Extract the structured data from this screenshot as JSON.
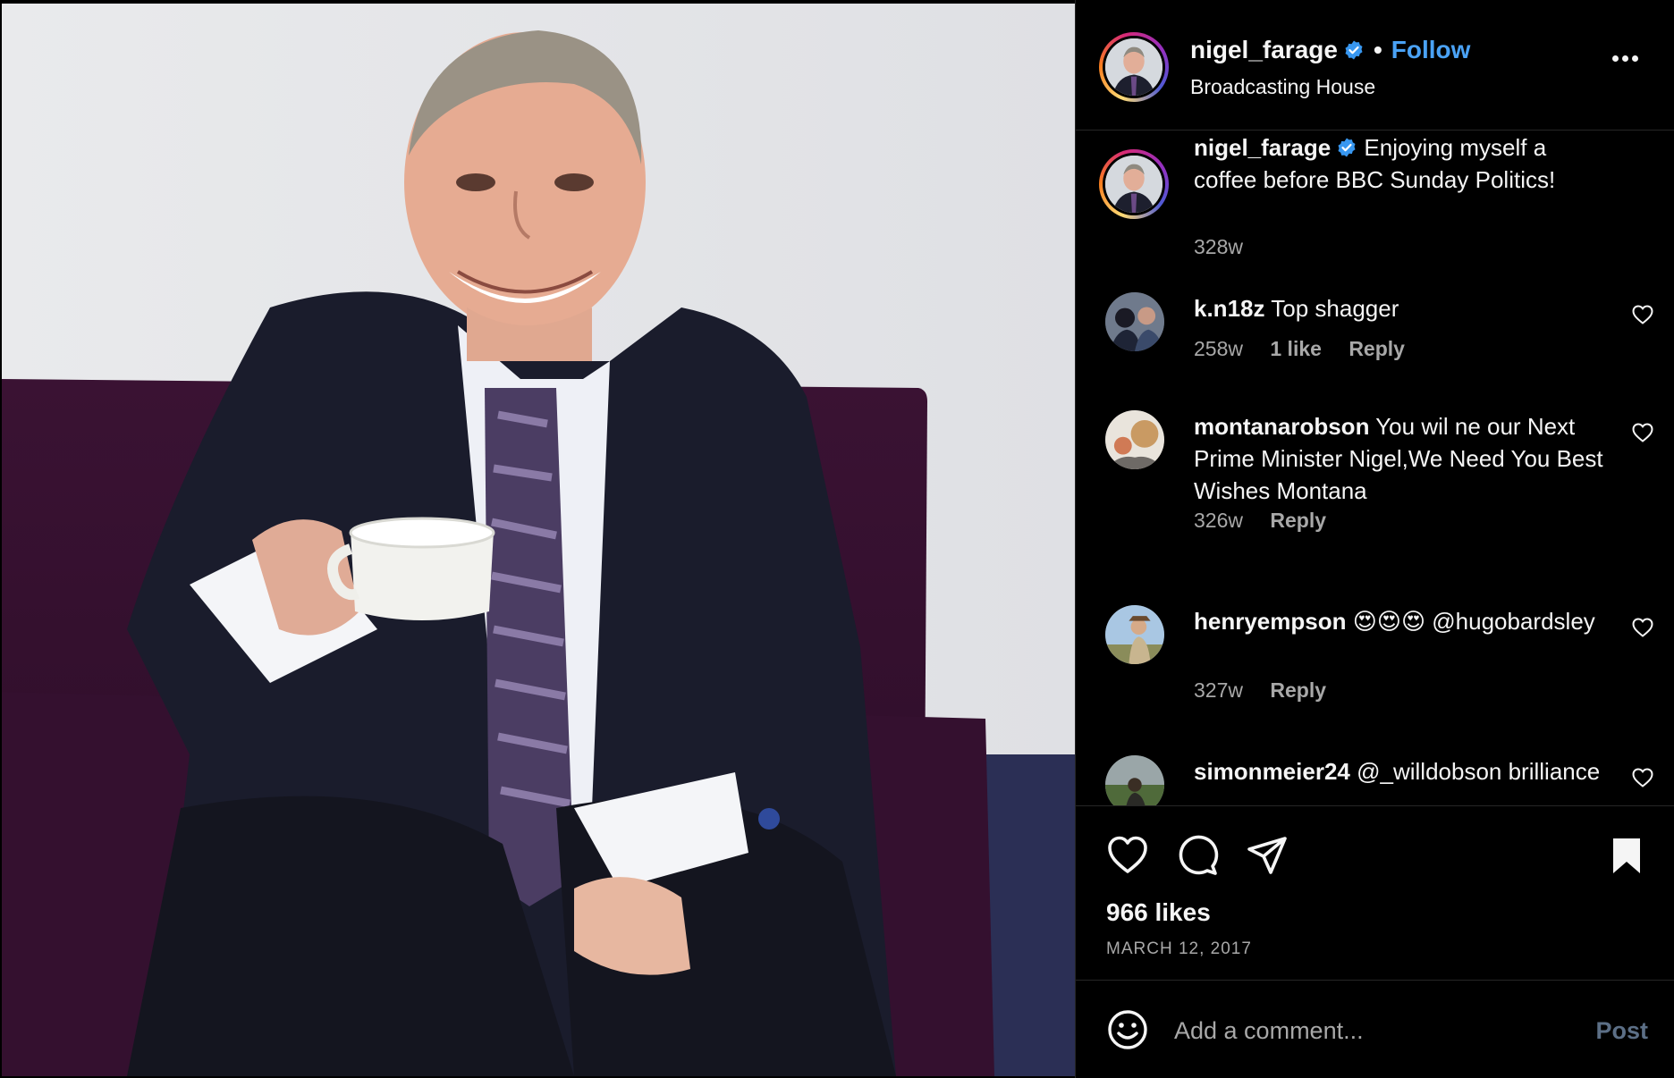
{
  "post": {
    "author": "nigel_farage",
    "follow_label": "Follow",
    "dot": "•",
    "location": "Broadcasting House",
    "caption": {
      "username": "nigel_farage",
      "text": "Enjoying myself a coffee before BBC Sunday Politics!",
      "age": "328w"
    },
    "likes": "966 likes",
    "date": "MARCH 12, 2017"
  },
  "comments": [
    {
      "username": "k.n18z",
      "text": "Top shagger",
      "age": "258w",
      "likes": "1 like",
      "reply": "Reply"
    },
    {
      "username": "montanarobson",
      "text": "You wil ne our Next Prime Minister Nigel,We Need You Best Wishes Montana",
      "age": "326w",
      "reply": "Reply"
    },
    {
      "username": "henryempson",
      "text": "😍😍😍 @hugobardsley",
      "age": "327w",
      "reply": "Reply"
    },
    {
      "username": "simonmeier24",
      "text": "@_willdobson brilliance"
    }
  ],
  "add_comment": {
    "placeholder": "Add a comment...",
    "post_label": "Post"
  },
  "colors": {
    "accent": "#4aa2f5",
    "muted_text": "#a8a8a8",
    "background": "#000000",
    "post_disabled": "#5c6f86"
  },
  "icons": [
    "verified-badge-icon",
    "more-options-icon",
    "heart-icon",
    "comment-icon",
    "share-icon",
    "bookmark-icon",
    "emoji-icon"
  ]
}
